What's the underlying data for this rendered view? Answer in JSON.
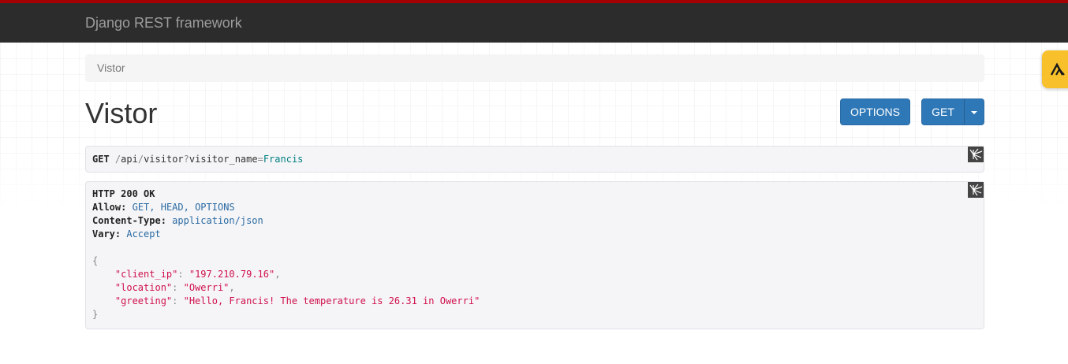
{
  "navbar": {
    "brand": "Django REST framework"
  },
  "breadcrumb": {
    "current": "Vistor"
  },
  "page": {
    "title": "Vistor"
  },
  "buttons": {
    "options_label": "OPTIONS",
    "get_label": "GET"
  },
  "request": {
    "method": "GET",
    "slash1": "/",
    "seg1": "api",
    "slash2": "/",
    "seg2": "visitor",
    "qmark": "?",
    "param_key": "visitor_name",
    "eq": "=",
    "param_value": "Francis"
  },
  "response": {
    "status": "HTTP 200 OK",
    "headers": [
      {
        "name": "Allow:",
        "value": "GET, HEAD, OPTIONS"
      },
      {
        "name": "Content-Type:",
        "value": "application/json"
      },
      {
        "name": "Vary:",
        "value": "Accept"
      }
    ],
    "open_brace": "{",
    "close_brace": "}",
    "fields": [
      {
        "key": "\"client_ip\"",
        "value": "\"197.210.79.16\"",
        "sep": ","
      },
      {
        "key": "\"location\"",
        "value": "\"Owerri\"",
        "sep": ","
      },
      {
        "key": "\"greeting\"",
        "value": "\"Hello, Francis! The temperature is 26.31 in Owerri\"",
        "sep": ""
      }
    ]
  },
  "colors": {
    "navbar_bg": "#2c2c2c",
    "navbar_accent": "#a30000",
    "button_primary": "#2f78b7",
    "json_string": "#d0104c",
    "header_value": "#2a6aa3",
    "badge": "#f8c12b"
  },
  "icons": {
    "format_icon": "broken-glass-icon",
    "badge_icon": "arrow-up-chevron-icon"
  }
}
